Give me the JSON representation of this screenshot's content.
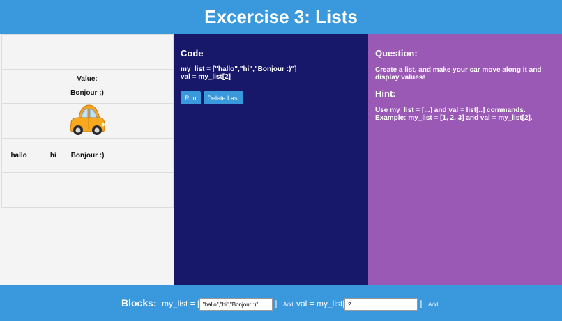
{
  "header": {
    "title": "Excercise 3: Lists"
  },
  "grid": {
    "value_label": "Value:",
    "value_text": "Bonjour :)",
    "row3": [
      "hallo",
      "hi",
      "Bonjour :)"
    ]
  },
  "code": {
    "title": "Code",
    "line1": "my_list = [\"hallo\",\"hi\",\"Bonjour :)\"]",
    "line2": "val = my_list[2]",
    "run_label": "Run",
    "delete_label": "Delete Last"
  },
  "question": {
    "title": "Question:",
    "text": "Create a list, and make your car move along it and display values!",
    "hint_title": "Hint:",
    "hint_line1": "Use my_list = [...] and val = list[..] commands.",
    "hint_line2": "Example: my_list = [1, 2, 3] and val = my_list[2]."
  },
  "footer": {
    "blocks_label": "Blocks:",
    "list_prefix": "my_list = [",
    "list_value": "\"hallo\",\"hi\",\"Bonjour :)\"",
    "list_suffix": "]",
    "add_label": "Add",
    "val_prefix": "val = my_list[",
    "val_value": "2",
    "val_suffix": "]",
    "add2_label": "Add"
  },
  "colors": {
    "accent_blue": "#3a98dc",
    "code_bg": "#18186b",
    "question_bg": "#9b59b6",
    "car_body": "#f5a623"
  }
}
